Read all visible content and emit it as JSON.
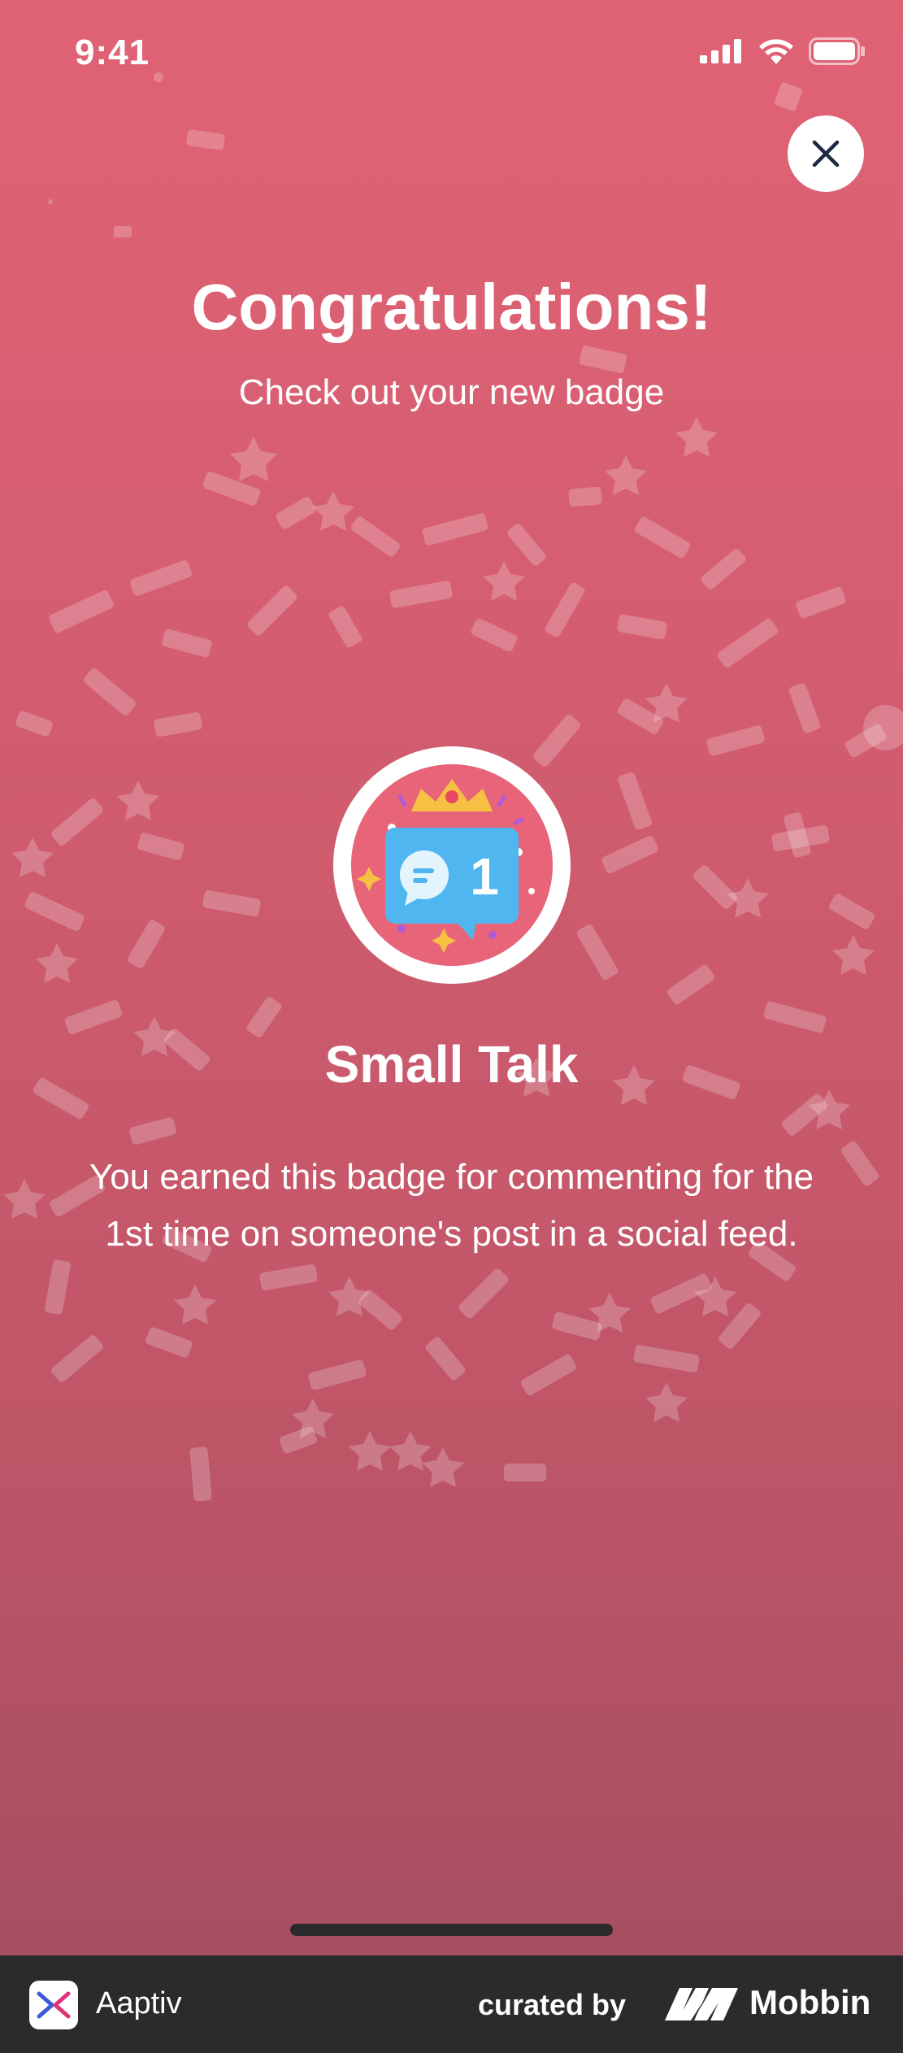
{
  "status_bar": {
    "time": "9:41",
    "icons": [
      "signal-icon",
      "wifi-icon",
      "battery-icon"
    ]
  },
  "close_button": {
    "icon": "close-icon"
  },
  "celebration": {
    "title": "Congratulations!",
    "subtitle": "Check out your new badge"
  },
  "badge": {
    "name": "Small Talk",
    "icon_label": "1",
    "description": "You earned this badge for commenting for the 1st time on someone's post in a social feed."
  },
  "footer": {
    "app_name": "Aaptiv",
    "curated_by": "curated by",
    "brand": "Mobbin"
  },
  "colors": {
    "background_top": "#e06374",
    "background_bottom": "#a64f61",
    "text": "#ffffff",
    "badge_blue": "#4fb6f0",
    "badge_crown": "#f6c142",
    "footer_bg": "#2b2b2d"
  }
}
